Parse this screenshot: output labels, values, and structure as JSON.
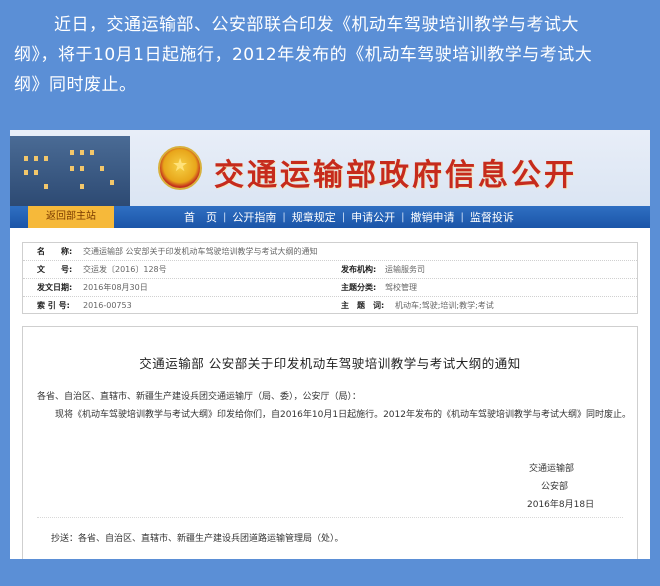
{
  "intro": {
    "line1": "近日，交通运输部、公安部联合印发《机动车驾驶培训教学与考试大",
    "line2": "纲》，将于10月1日起施行，2012年发布的《机动车驾驶培训教学与考试大",
    "line3": "纲》同时废止。"
  },
  "header": {
    "site_title": "交通运输部政府信息公开",
    "emblem_icon": "national-emblem-icon"
  },
  "nav": {
    "home_button": "返回部主站",
    "items": [
      "首　页",
      "公开指南",
      "规章规定",
      "申请公开",
      "撤销申请",
      "监督投诉"
    ]
  },
  "meta": {
    "name_label": "名　　称:",
    "name_value": "交通运输部 公安部关于印发机动车驾驶培训教学与考试大纲的通知",
    "doc_no_label": "文　　号:",
    "doc_no_value": "交运发〔2016〕128号",
    "agency_label": "发布机构:",
    "agency_value": "运输服务司",
    "date_label": "发文日期:",
    "date_value": "2016年08月30日",
    "category_label": "主题分类:",
    "category_value": "驾校管理",
    "index_label": "索 引 号:",
    "index_value": "2016-00753",
    "keywords_label": "主　题　词:",
    "keywords_value": "机动车;驾驶;培训;教学;考试"
  },
  "notice": {
    "title": "交通运输部 公安部关于印发机动车驾驶培训教学与考试大纲的通知",
    "addressee": "各省、自治区、直辖市、新疆生产建设兵团交通运输厅（局、委），公安厅（局）：",
    "body": "现将《机动车驾驶培训教学与考试大纲》印发给你们，自2016年10月1日起施行。2012年发布的《机动车驾驶培训教学与考试大纲》同时废止。",
    "signer1": "交通运输部",
    "signer2": "公安部",
    "sign_date": "2016年8月18日",
    "cc": "抄送：各省、自治区、直辖市、新疆生产建设兵团道路运输管理局（处）。"
  }
}
